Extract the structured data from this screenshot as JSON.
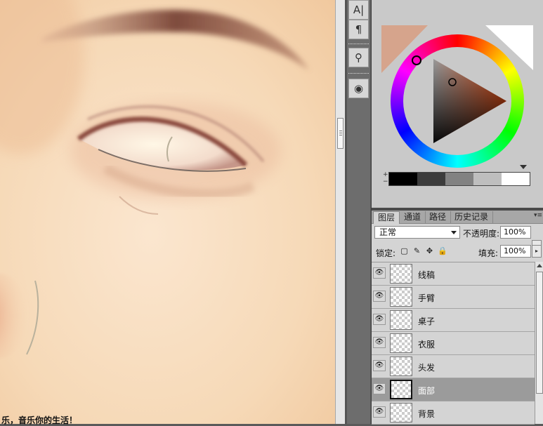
{
  "canvas": {
    "caption": "乐，音乐你的生活！"
  },
  "toolstrip": {
    "buttons": [
      {
        "icon": "character-panel-icon",
        "glyph": "A|"
      },
      {
        "icon": "paragraph-panel-icon",
        "glyph": "¶"
      },
      {
        "icon": "brushes-panel-icon",
        "glyph": "⚲"
      },
      {
        "icon": "clone-source-icon",
        "glyph": "◉"
      }
    ]
  },
  "color_panel": {
    "background_swatch": "#d6a48c",
    "foreground_swatch": "#ffffff",
    "gray_ramp": [
      "#000000",
      "#3c3c3c",
      "#828282",
      "#bebebe",
      "#ffffff"
    ],
    "plus": "+",
    "minus": "−"
  },
  "layers_panel": {
    "tabs": [
      "图层",
      "通道",
      "路径",
      "历史记录"
    ],
    "active_tab": "图层",
    "menu_glyph": "▾≡",
    "blend_mode": "正常",
    "opacity_label": "不透明度:",
    "opacity_value": "100%",
    "lock_label": "锁定:",
    "lock_icons": [
      "lock-transparency-icon",
      "lock-pixels-icon",
      "lock-position-icon",
      "lock-all-icon"
    ],
    "fill_label": "填充:",
    "fill_value": "100%",
    "layers": [
      {
        "name": "线稿",
        "visible": true,
        "selected": false
      },
      {
        "name": "手臂",
        "visible": true,
        "selected": false
      },
      {
        "name": "桌子",
        "visible": true,
        "selected": false
      },
      {
        "name": "衣服",
        "visible": true,
        "selected": false
      },
      {
        "name": "头发",
        "visible": true,
        "selected": false
      },
      {
        "name": "面部",
        "visible": true,
        "selected": true
      },
      {
        "name": "背景",
        "visible": true,
        "selected": false
      }
    ]
  }
}
